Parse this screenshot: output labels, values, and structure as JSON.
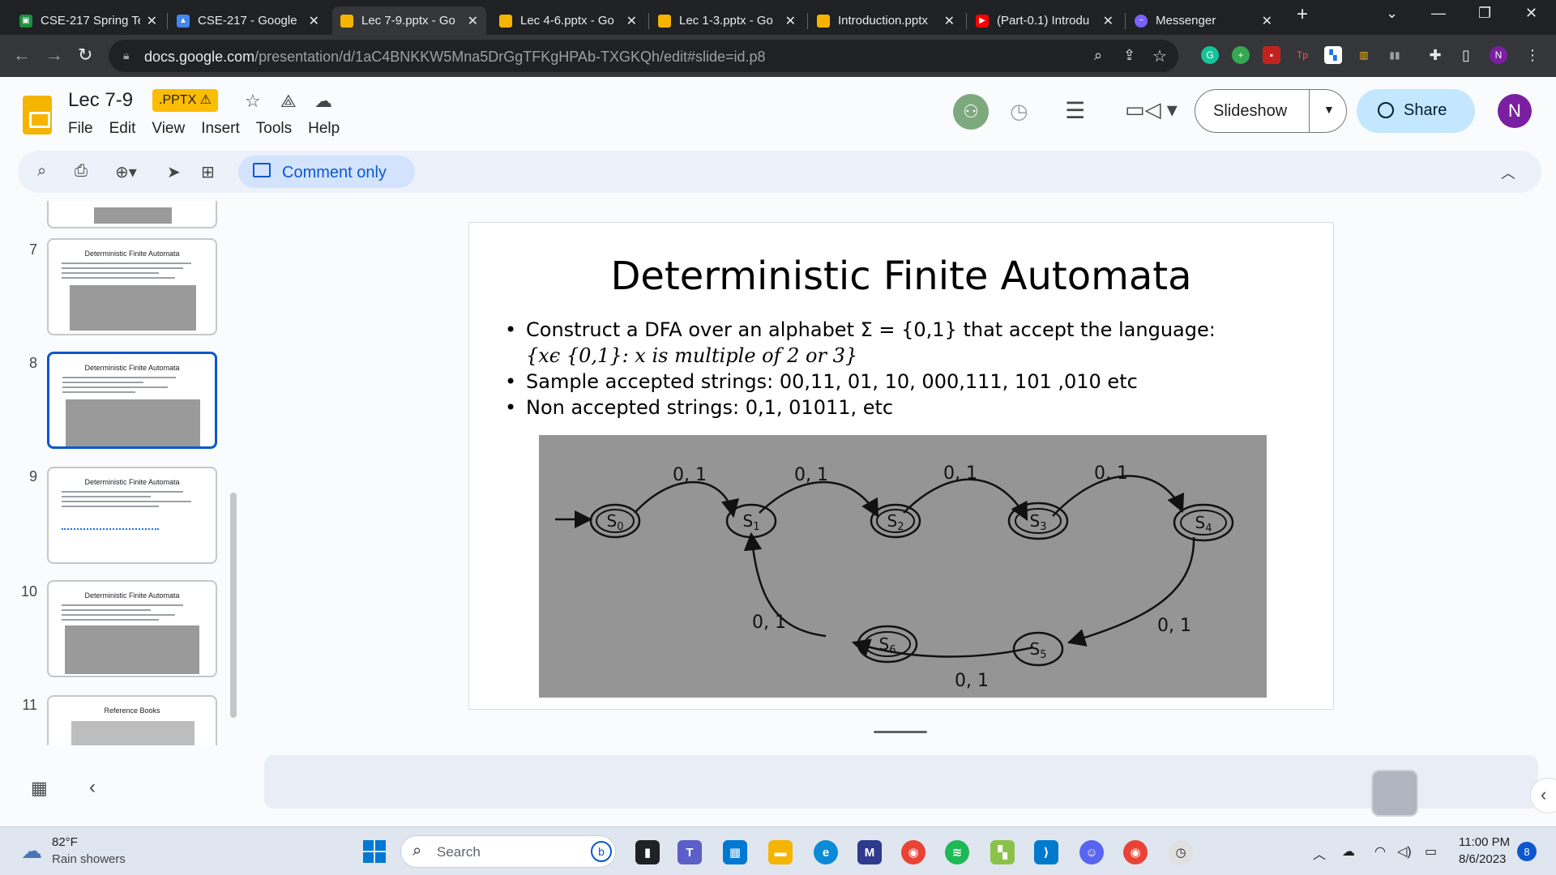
{
  "browser": {
    "tabs": [
      {
        "title": "CSE-217 Spring Te",
        "icon": "classroom-icon",
        "color": "#1e8e3e"
      },
      {
        "title": "CSE-217 - Google",
        "icon": "drive-icon",
        "color": "#4285f4"
      },
      {
        "title": "Lec 7-9.pptx - Go",
        "icon": "slides-icon",
        "color": "#f4b400"
      },
      {
        "title": "Lec 4-6.pptx - Go",
        "icon": "slides-icon",
        "color": "#f4b400"
      },
      {
        "title": "Lec 1-3.pptx - Go",
        "icon": "slides-icon",
        "color": "#f4b400"
      },
      {
        "title": "Introduction.pptx",
        "icon": "slides-icon",
        "color": "#f4b400"
      },
      {
        "title": "(Part-0.1) Introdu",
        "icon": "youtube-icon",
        "color": "#ff0000"
      },
      {
        "title": "Messenger",
        "icon": "messenger-icon",
        "color": "#7b61ff"
      }
    ],
    "url_host": "docs.google.com",
    "url_path": "/presentation/d/1aC4BNKKW5Mna5DrGgTFKgHPAb-TXGKQh/edit#slide=id.p8",
    "profile_initial": "N"
  },
  "app": {
    "doc_title": "Lec 7-9",
    "format_badge": ".PPTX ⚠",
    "menu": [
      "File",
      "Edit",
      "View",
      "Insert",
      "Tools",
      "Help"
    ],
    "slideshow_label": "Slideshow",
    "share_label": "Share",
    "user_initial": "N",
    "comment_only_label": "Comment only"
  },
  "filmstrip": {
    "slides": [
      {
        "number": "7",
        "title": "Deterministic Finite Automata"
      },
      {
        "number": "8",
        "title": "Deterministic Finite Automata"
      },
      {
        "number": "9",
        "title": "Deterministic Finite Automata"
      },
      {
        "number": "10",
        "title": "Deterministic Finite Automata"
      },
      {
        "number": "11",
        "title": "Reference Books"
      }
    ],
    "selected_slide": "8"
  },
  "slide": {
    "title": "Deterministic Finite Automata",
    "bullet1": "Construct a DFA over an alphabet Σ = {0,1}  that accept the language:",
    "bullet1_cont": "{xϵ {0,1}: x is multiple of 2 or 3}",
    "bullet2": "Sample accepted strings: 00,11, 01, 10, 000,111, 101 ,010 etc",
    "bullet3": "Non accepted strings: 0,1, 01011, etc",
    "diagram": {
      "states": [
        "S0",
        "S1",
        "S2",
        "S3",
        "S4",
        "S5",
        "S6"
      ],
      "edge_label": "0, 1"
    }
  },
  "taskbar": {
    "weather_temp": "82°F",
    "weather_desc": "Rain showers",
    "search_label": "Search",
    "time": "11:00 PM",
    "date": "8/6/2023",
    "notification_count": "8"
  }
}
